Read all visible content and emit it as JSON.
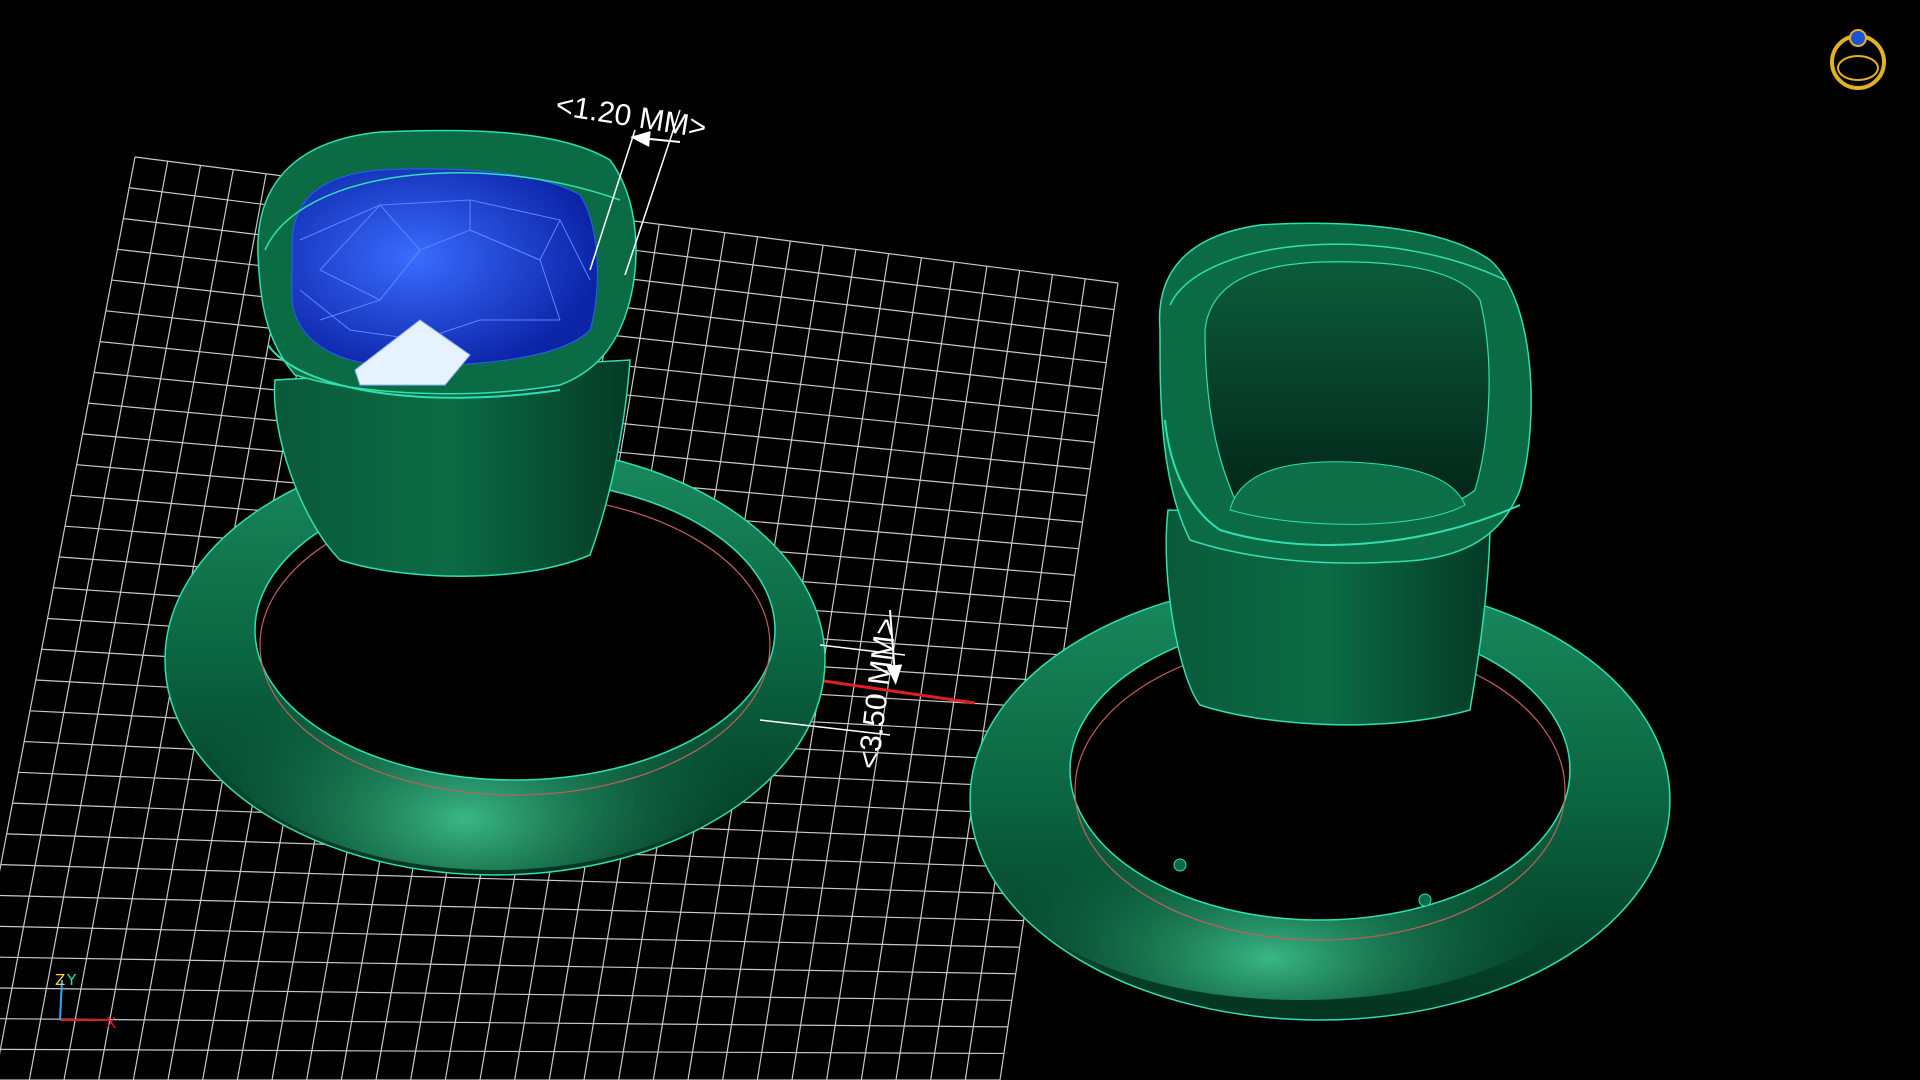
{
  "viewport": {
    "background": "#000000",
    "grid_color": "#c8c8c8",
    "model_color": "#0b6b45",
    "edge_color": "#2fe0b0",
    "gem_color": "#1a3fd0"
  },
  "dimensions": [
    {
      "label": "<1.20 MM>"
    },
    {
      "label": "<3.50 MM>"
    }
  ],
  "axis_triad": {
    "z": "Z",
    "y": "Y",
    "x": "X"
  },
  "app_icon": "ring-logo-icon"
}
